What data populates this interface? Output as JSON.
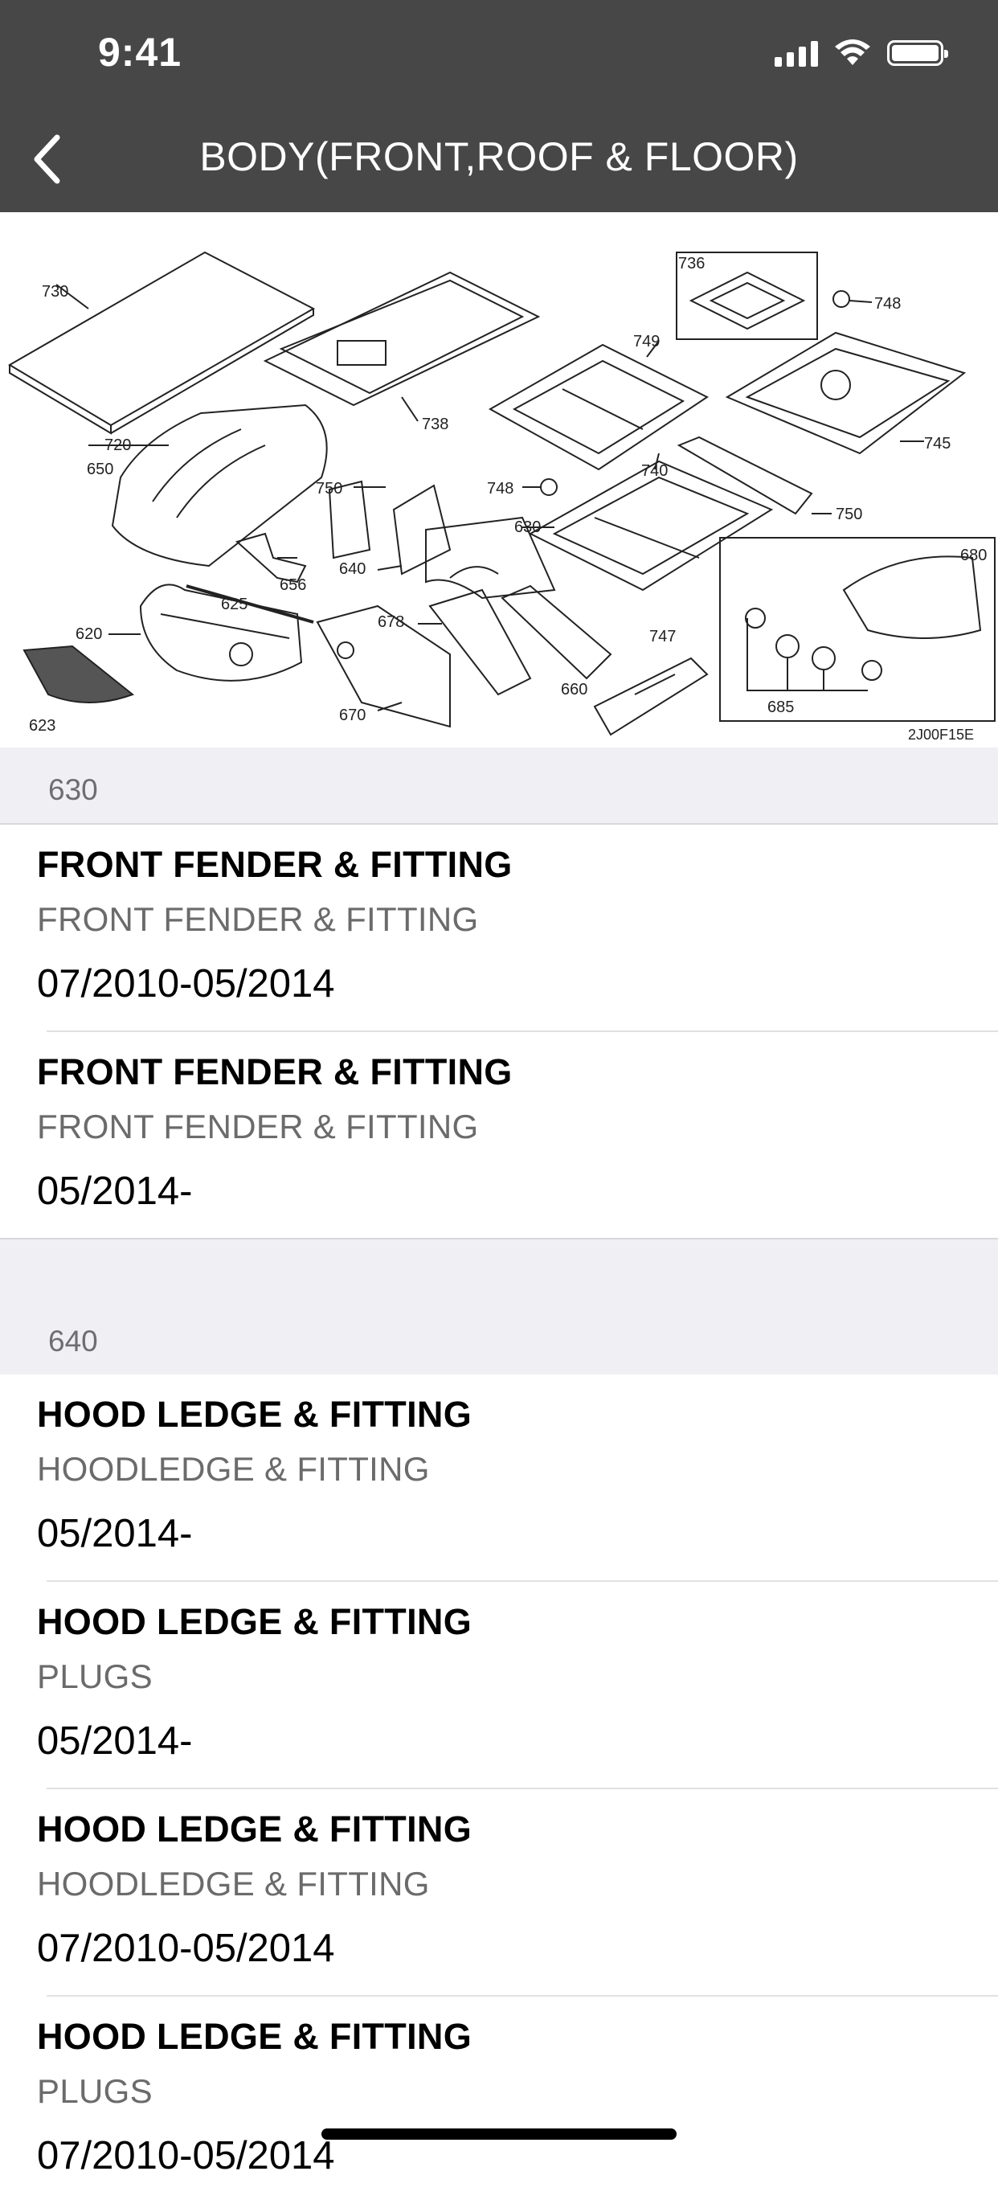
{
  "status_bar": {
    "time": "9:41"
  },
  "nav": {
    "title": "BODY(FRONT,ROOF & FLOOR)"
  },
  "diagram": {
    "labels": {
      "l730": "730",
      "l736": "736",
      "l748a": "748",
      "l749": "749",
      "l738": "738",
      "l745": "745",
      "l720": "720",
      "l650": "650",
      "l750a": "750",
      "l748b": "748",
      "l740": "740",
      "l630": "630",
      "l750b": "750",
      "l640": "640",
      "l680": "680",
      "l656": "656",
      "l625": "625",
      "l620": "620",
      "l678": "678",
      "l747": "747",
      "l660": "660",
      "l670": "670",
      "l685": "685",
      "l623": "623",
      "code": "2J00F15E"
    }
  },
  "sections": [
    {
      "code": "630",
      "items": [
        {
          "name": "FRONT FENDER & FITTING",
          "desc": "FRONT FENDER & FITTING",
          "date": "07/2010-05/2014"
        },
        {
          "name": "FRONT FENDER & FITTING",
          "desc": "FRONT FENDER & FITTING",
          "date": "05/2014-"
        }
      ]
    },
    {
      "code": "640",
      "items": [
        {
          "name": "HOOD LEDGE & FITTING",
          "desc": "HOODLEDGE & FITTING",
          "date": "05/2014-"
        },
        {
          "name": "HOOD LEDGE & FITTING",
          "desc": "PLUGS",
          "date": "05/2014-"
        },
        {
          "name": "HOOD LEDGE & FITTING",
          "desc": "HOODLEDGE & FITTING",
          "date": "07/2010-05/2014"
        },
        {
          "name": "HOOD LEDGE & FITTING",
          "desc": "PLUGS",
          "date": "07/2010-05/2014"
        }
      ]
    }
  ]
}
